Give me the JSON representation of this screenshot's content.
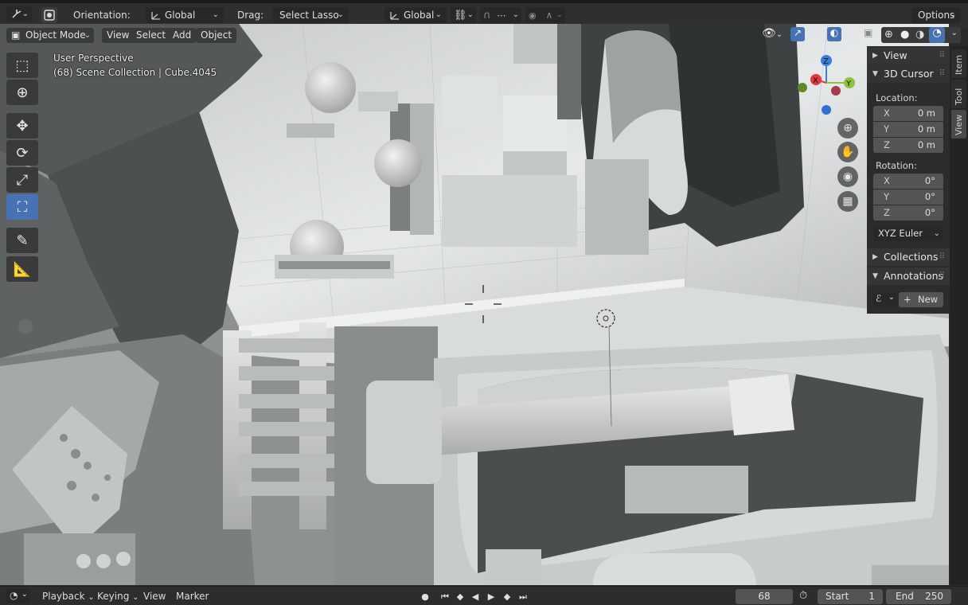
{
  "header": {
    "orientation_label": "Orientation:",
    "orientation_value": "Global",
    "drag_label": "Drag:",
    "drag_value": "Select Lasso",
    "transform_orientation": "Global",
    "options_label": "Options"
  },
  "viewport_header": {
    "mode": "Object Mode",
    "menus": [
      "View",
      "Select",
      "Add",
      "Object"
    ]
  },
  "viewport": {
    "perspective": "User Perspective",
    "scene_info": "(68) Scene Collection | Cube.4045",
    "gizmo": {
      "x": "X",
      "y": "Y",
      "z": "Z"
    }
  },
  "toolbar": {
    "tools": [
      "select-box-icon",
      "cursor-icon",
      "move-icon",
      "rotate-icon",
      "scale-icon",
      "transform-icon",
      "annotate-icon",
      "measure-icon"
    ],
    "active": "transform-icon"
  },
  "sidebar": {
    "view_section": "View",
    "cursor_section": "3D Cursor",
    "location_label": "Location:",
    "location": [
      {
        "axis": "X",
        "value": "0 m"
      },
      {
        "axis": "Y",
        "value": "0 m"
      },
      {
        "axis": "Z",
        "value": "0 m"
      }
    ],
    "rotation_label": "Rotation:",
    "rotation": [
      {
        "axis": "X",
        "value": "0°"
      },
      {
        "axis": "Y",
        "value": "0°"
      },
      {
        "axis": "Z",
        "value": "0°"
      }
    ],
    "rotation_mode": "XYZ Euler",
    "collections_section": "Collections",
    "annotations_section": "Annotations",
    "new_button": "New"
  },
  "tabs": [
    "Item",
    "Tool",
    "View"
  ],
  "timeline": {
    "playback": "Playback",
    "keying": "Keying",
    "view": "View",
    "marker": "Marker",
    "current_frame": "68",
    "start_label": "Start",
    "start_value": "1",
    "end_label": "End",
    "end_value": "250"
  },
  "colors": {
    "accent": "#4772b3",
    "gizmo_x": "#e0393e",
    "gizmo_y": "#8bc43a",
    "gizmo_z": "#3a7fe0"
  }
}
